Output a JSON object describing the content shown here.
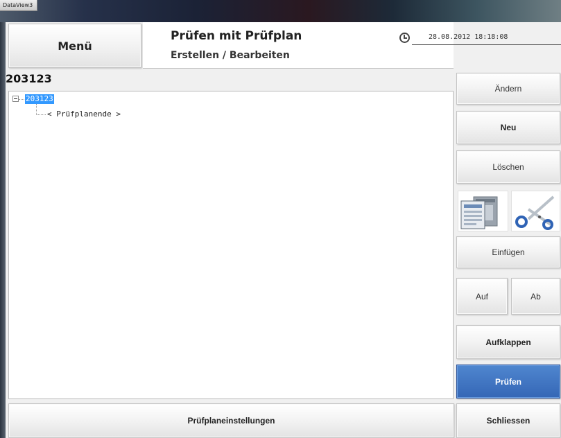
{
  "window": {
    "title": "DataView3"
  },
  "header": {
    "menu_label": "Menü",
    "title": "Prüfen mit Prüfplan",
    "subtitle": "Erstellen / Bearbeiten",
    "datetime": "28.08.2012  18:18:08"
  },
  "plan": {
    "title": "203123",
    "tree": {
      "root_label": "203123",
      "child_label": "< Prüfplanende >"
    }
  },
  "sidebar": {
    "aendern": "Ändern",
    "neu": "Neu",
    "loeschen": "Löschen",
    "einfuegen": "Einfügen",
    "auf": "Auf",
    "ab": "Ab",
    "aufklappen": "Aufklappen",
    "pruefen": "Prüfen"
  },
  "footer": {
    "settings_label": "Prüfplaneinstellungen",
    "close_label": "Schliessen"
  },
  "icons": {
    "copy": "copy-icon",
    "cut": "scissors-icon",
    "clock": "clock-icon"
  },
  "colors": {
    "accent": "#3567b6",
    "selection": "#3399ff"
  }
}
